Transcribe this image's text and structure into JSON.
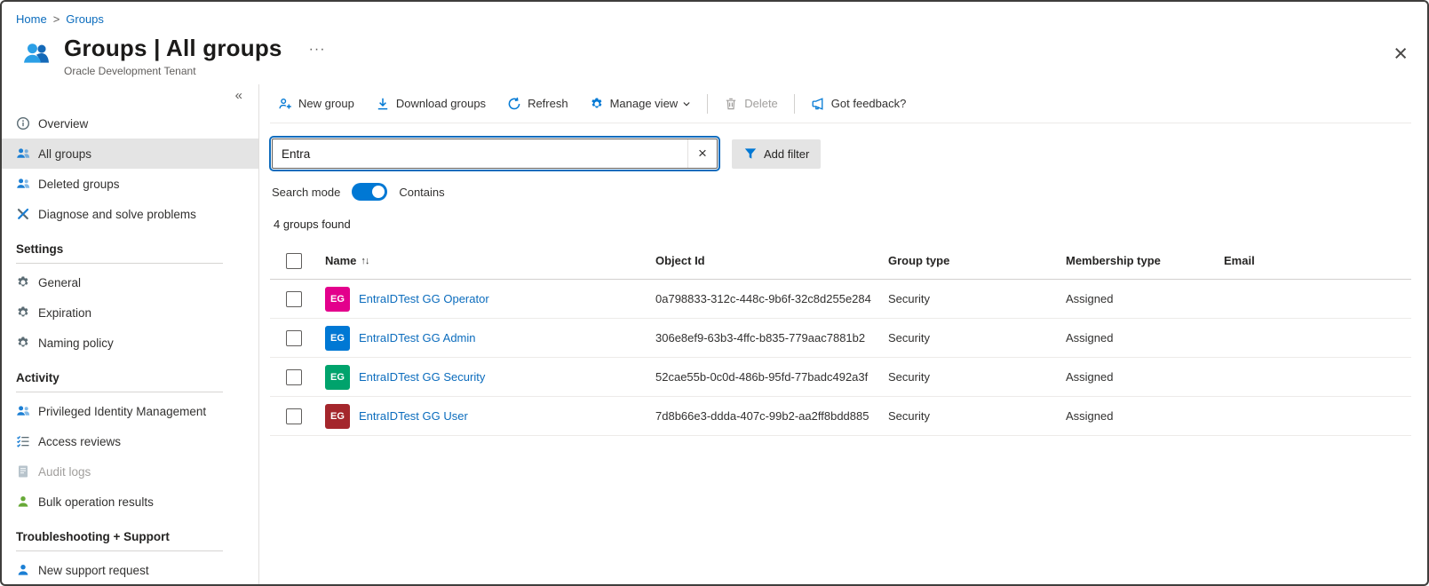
{
  "breadcrumb": {
    "home": "Home",
    "separator": ">",
    "current": "Groups"
  },
  "header": {
    "title": "Groups | All groups",
    "subtitle": "Oracle Development Tenant",
    "more": "···",
    "close": "×"
  },
  "sidebar": {
    "collapse": "«",
    "items": [
      {
        "label": "Overview"
      },
      {
        "label": "All groups"
      },
      {
        "label": "Deleted groups"
      },
      {
        "label": "Diagnose and solve problems"
      },
      {
        "label": "Settings"
      },
      {
        "label": "General"
      },
      {
        "label": "Expiration"
      },
      {
        "label": "Naming policy"
      },
      {
        "label": "Activity"
      },
      {
        "label": "Privileged Identity Management"
      },
      {
        "label": "Access reviews"
      },
      {
        "label": "Audit logs"
      },
      {
        "label": "Bulk operation results"
      },
      {
        "label": "Troubleshooting + Support"
      },
      {
        "label": "New support request"
      }
    ]
  },
  "toolbar": {
    "new_group": "New group",
    "download_groups": "Download groups",
    "refresh": "Refresh",
    "manage_view": "Manage view",
    "delete": "Delete",
    "feedback": "Got feedback?"
  },
  "filters": {
    "search_value": "Entra",
    "clear": "×",
    "add_filter": "Add filter",
    "search_mode_label": "Search mode",
    "search_mode_value": "Contains",
    "toggle_state": "on"
  },
  "results": {
    "count": "4 groups found"
  },
  "table": {
    "headers": {
      "name": "Name",
      "sort": "↑↓",
      "object_id": "Object Id",
      "group_type": "Group type",
      "membership_type": "Membership type",
      "email": "Email"
    },
    "rows": [
      {
        "avatar": "EG",
        "avatar_color": "#e3008c",
        "name": "EntraIDTest GG Operator",
        "object_id": "0a798833-312c-448c-9b6f-32c8d255e284",
        "group_type": "Security",
        "membership_type": "Assigned",
        "email": ""
      },
      {
        "avatar": "EG",
        "avatar_color": "#0078d4",
        "name": "EntraIDTest GG Admin",
        "object_id": "306e8ef9-63b3-4ffc-b835-779aac7881b2",
        "group_type": "Security",
        "membership_type": "Assigned",
        "email": ""
      },
      {
        "avatar": "EG",
        "avatar_color": "#00a36c",
        "name": "EntraIDTest GG Security",
        "object_id": "52cae55b-0c0d-486b-95fd-77badc492a3f",
        "group_type": "Security",
        "membership_type": "Assigned",
        "email": ""
      },
      {
        "avatar": "EG",
        "avatar_color": "#a4262c",
        "name": "EntraIDTest GG User",
        "object_id": "7d8b66e3-ddda-407c-99b2-aa2ff8bdd885",
        "group_type": "Security",
        "membership_type": "Assigned",
        "email": ""
      }
    ]
  },
  "colors": {
    "accent": "#0078d4"
  }
}
